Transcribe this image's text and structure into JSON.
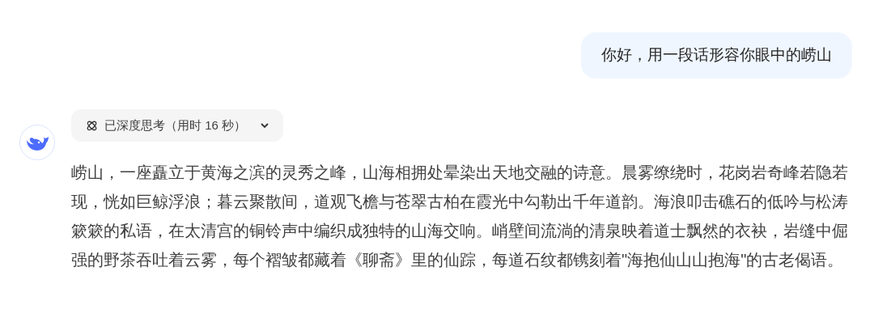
{
  "user_message": {
    "text": "你好，用一段话形容你眼中的崂山"
  },
  "assistant_message": {
    "thinking": {
      "label": "已深度思考（用时 16 秒）",
      "expanded": false
    },
    "text": "崂山，一座矗立于黄海之滨的灵秀之峰，山海相拥处晕染出天地交融的诗意。晨雾缭绕时，花岗岩奇峰若隐若现，恍如巨鲸浮浪；暮云聚散间，道观飞檐与苍翠古柏在霞光中勾勒出千年道韵。海浪叩击礁石的低吟与松涛簌簌的私语，在太清宫的铜铃声中编织成独特的山海交响。峭壁间流淌的清泉映着道士飘然的衣袂，岩缝中倔强的野茶吞吐着云雾，每个褶皱都藏着《聊斋》里的仙踪，每道石纹都镌刻着\"海抱仙山山抱海\"的古老偈语。"
  }
}
